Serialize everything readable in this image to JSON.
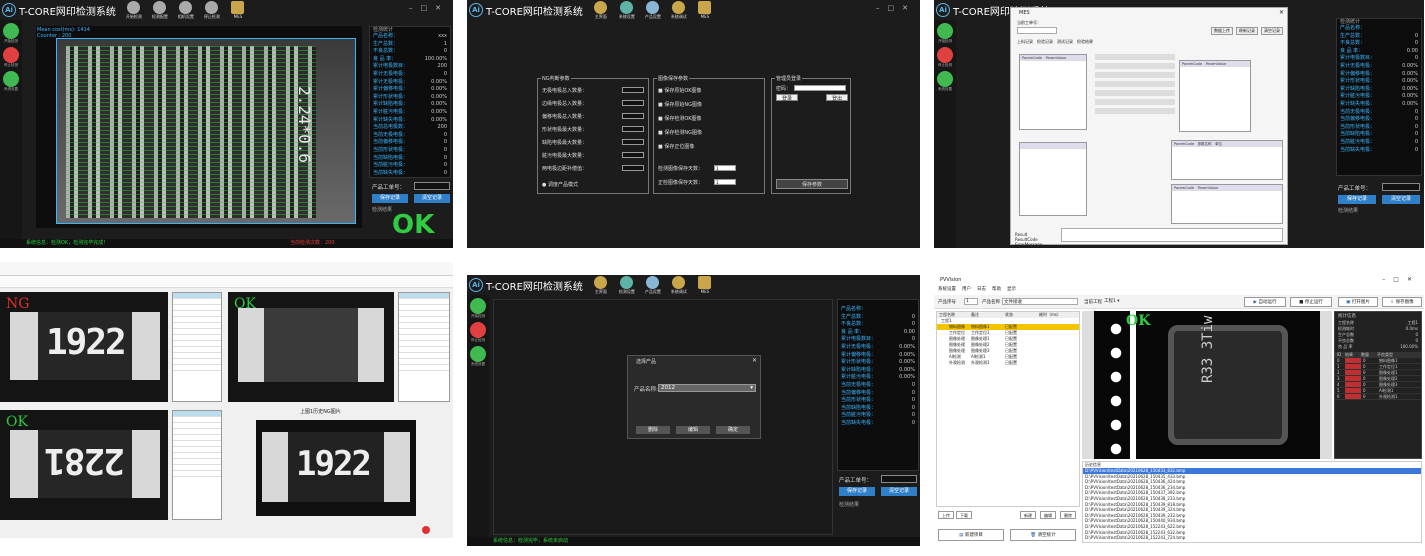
{
  "app": {
    "logo": "Ai",
    "title": "T-CORE网印检测系统"
  },
  "toolbar_colors": {
    "tool1": "#c9a64a",
    "tool2": "#5fb3a6",
    "tool3": "#8ab6d6",
    "tool4": "#c9a64a"
  },
  "panel1": {
    "toolbar": [
      "开始检测",
      "检测配置",
      "相机设置",
      "停止检测",
      "MES"
    ],
    "side": [
      "开始检测",
      "停止检测",
      "系统设置"
    ],
    "overlay_lines": [
      "Mean cost(ms): 1414",
      "Counter : 200"
    ],
    "result_group": "检测统计",
    "stats": [
      {
        "label": "产品名称：",
        "value": "xxx"
      },
      {
        "label": "生产总数：",
        "value": "1"
      },
      {
        "label": "不良总数：",
        "value": "0"
      },
      {
        "label": "良 品 率：",
        "value": "100.00%"
      },
      {
        "label": "累计电极数目：",
        "value": "200"
      },
      {
        "label": "累计无极电极：",
        "value": "0"
      },
      {
        "label": "累计无极电极：",
        "value": "0.00%"
      },
      {
        "label": "累计偏移电极：",
        "value": "0.00%"
      },
      {
        "label": "累计形状电极：",
        "value": "0.00%"
      },
      {
        "label": "累计缺陷电极：",
        "value": "0.00%"
      },
      {
        "label": "累计脏污电极：",
        "value": "0.00%"
      },
      {
        "label": "累计缺失电极：",
        "value": "0.00%"
      },
      {
        "label": "当前总电极数：",
        "value": "200"
      },
      {
        "label": "当前无极电极：",
        "value": "0"
      },
      {
        "label": "当前偏移电极：",
        "value": "0"
      },
      {
        "label": "当前形状电极：",
        "value": "0"
      },
      {
        "label": "当前缺陷电极：",
        "value": "0"
      },
      {
        "label": "当前脏污电极：",
        "value": "0"
      },
      {
        "label": "当前缺失电极：",
        "value": "0"
      }
    ],
    "product_no_label": "产品工单号：",
    "save_btn": "保存记录",
    "clear_btn": "清空记录",
    "result_label": "检测结果",
    "result_text": "OK",
    "status": "系统信息：检测OK，检测完毕完成！",
    "status_right": "当前检测次数：200",
    "image_text": "2.24*0.6"
  },
  "panel2": {
    "toolbar": [
      "主界面",
      "系统设置",
      "产品设置",
      "系统调试",
      "MES"
    ],
    "group1": "NG判断参数",
    "group1_rows": [
      "无极电极总入数量：",
      "边缘电极总入数量：",
      "偏移电极总入数量：",
      "形状电极最大数量：",
      "缺陷电极最大数量：",
      "脏污电极最大数量：",
      "两电极边距补偿值："
    ],
    "group1_check": "调度产品模式",
    "group2": "图像保存参数",
    "group2_rows": [
      "保存原始OK图像",
      "保存原始NG图像",
      "保存检测OK图像",
      "保存检测NG图像",
      "保存正位图像"
    ],
    "group2_inputs": [
      {
        "label": "检测图像保存天数：",
        "value": "1"
      },
      {
        "label": "正检图像保存天数：",
        "value": "1"
      }
    ],
    "group3": "管理员登录",
    "group3_pw": "密码：",
    "login_btn": "登录",
    "logout_btn": "登出",
    "save_params": "保存参数"
  },
  "panel3": {
    "dialog_title": "MES",
    "top_label": "当前工单号：",
    "tabs": [
      "上料记录",
      "检验记录",
      "测试记录",
      "检验结果"
    ],
    "right_btns": [
      "数据上传",
      "刷新记录",
      "清空记录"
    ],
    "grid1_headers": [
      "ParamCode",
      "ParamValue",
      "Unit"
    ],
    "grid2_headers": [
      "ParamCode",
      "ParamValue",
      "ParamName"
    ],
    "grid3_headers": [
      "ParamCode",
      "参数名称",
      "单位"
    ],
    "msg_labels": [
      "Result",
      "ResultCode",
      "ErrorMessage"
    ],
    "stats_title": "检测统计",
    "stats": [
      {
        "label": "产品名称：",
        "value": ""
      },
      {
        "label": "生产总数：",
        "value": "0"
      },
      {
        "label": "不良总数：",
        "value": "0"
      },
      {
        "label": "良 品 率：",
        "value": "0.00"
      },
      {
        "label": "累计电极数目：",
        "value": "0"
      },
      {
        "label": "累计无极电极：",
        "value": "0.00%"
      },
      {
        "label": "累计偏移电极：",
        "value": "0.00%"
      },
      {
        "label": "累计形状电极：",
        "value": "0.00%"
      },
      {
        "label": "累计缺陷电极：",
        "value": "0.00%"
      },
      {
        "label": "累计脏污电极：",
        "value": "0.00%"
      },
      {
        "label": "累计缺失电极：",
        "value": "0.00%"
      },
      {
        "label": "当前无极电极：",
        "value": "0"
      },
      {
        "label": "当前偏移电极：",
        "value": "0"
      },
      {
        "label": "当前形状电极：",
        "value": "0"
      },
      {
        "label": "当前缺陷电极：",
        "value": "0"
      },
      {
        "label": "当前脏污电极：",
        "value": "0"
      },
      {
        "label": "当前缺失电极：",
        "value": "0"
      }
    ],
    "product_no_label": "产品工单号：",
    "save_btn": "保存记录",
    "clear_btn": "清空记录",
    "result_label": "检测结果"
  },
  "panel4": {
    "ng_text": "NG",
    "ok_text": "OK",
    "chip_text_a": "1922",
    "chip_text_b": "2281",
    "chip_text_c": "1922",
    "bottom_caption": "上图1历史NG图片"
  },
  "panel5": {
    "toolbar": [
      "主界面",
      "检测设置",
      "产品设置",
      "系统调试",
      "MES"
    ],
    "dialog_title": "选择产品",
    "product_label": "产品名称:",
    "product_value": "2012",
    "btns": [
      "删除",
      "编辑",
      "确定"
    ],
    "stats": [
      {
        "label": "产品名称：",
        "value": ""
      },
      {
        "label": "生产总数：",
        "value": "0"
      },
      {
        "label": "不良总数：",
        "value": "0"
      },
      {
        "label": "良 品 率：",
        "value": "0.00"
      },
      {
        "label": "累计电极数目：",
        "value": "0"
      },
      {
        "label": "累计无极电极：",
        "value": "0.00%"
      },
      {
        "label": "累计偏移电极：",
        "value": "0.00%"
      },
      {
        "label": "累计形状电极：",
        "value": "0.00%"
      },
      {
        "label": "累计缺陷电极：",
        "value": "0.00%"
      },
      {
        "label": "累计脏污电极：",
        "value": "0.00%"
      },
      {
        "label": "当前无极电极：",
        "value": "0"
      },
      {
        "label": "当前偏移电极：",
        "value": "0"
      },
      {
        "label": "当前形状电极：",
        "value": "0"
      },
      {
        "label": "当前缺陷电极：",
        "value": "0"
      },
      {
        "label": "当前脏污电极：",
        "value": "0"
      },
      {
        "label": "当前缺失电极：",
        "value": "0"
      }
    ],
    "product_no_label": "产品工单号：",
    "save_btn": "保存记录",
    "clear_btn": "清空记录",
    "result_label": "检测结果",
    "status": "系统信息：检测完毕，系统未启动"
  },
  "panel6": {
    "title": "PVVision",
    "menu": [
      "系统设置",
      "用户",
      "日志",
      "帮助",
      "显示"
    ],
    "product_no_label": "产品序号",
    "product_no": "1",
    "product_name_label": "产品名称",
    "product_name": "文件接收",
    "station_label": "当前工程",
    "station_value": "工程1",
    "top_btns": [
      "自动运行",
      "停止运行",
      "打开图片",
      "保存图像"
    ],
    "tree_header": [
      "工程名称",
      "备注",
      "状态",
      "耗时（ms）"
    ],
    "tree_rows": [
      [
        "工程1",
        "",
        "",
        ""
      ],
      [
        "物料图像",
        "物料图像1",
        "已配置",
        ""
      ],
      [
        "工作定位",
        "工作定位1",
        "已配置",
        ""
      ],
      [
        "图像处理",
        "图像处理1",
        "已配置",
        ""
      ],
      [
        "图像处理",
        "图像处理2",
        "已配置",
        ""
      ],
      [
        "图像处理",
        "图像处理3",
        "已配置",
        ""
      ],
      [
        "AI检测",
        "AI检测1",
        "已配置",
        ""
      ],
      [
        "外观检测",
        "外观检测1",
        "已配置",
        ""
      ]
    ],
    "ok_text": "OK",
    "chip_text": "R33 3Tiw",
    "info_title": "统计信息",
    "info_rows": [
      [
        "工程名称",
        "工程1"
      ],
      [
        "检测耗时",
        "0.0ms"
      ],
      [
        "生产总数",
        "0"
      ],
      [
        "不良总数",
        "0"
      ],
      [
        "良 品 率",
        "100.00%"
      ]
    ],
    "table_headers": [
      "ID",
      "结果",
      "数量",
      "不良类型"
    ],
    "table_rows": [
      [
        "0",
        "",
        "0",
        "物料图像1"
      ],
      [
        "1",
        "",
        "0",
        "工作定位1"
      ],
      [
        "2",
        "",
        "0",
        "图像处理1"
      ],
      [
        "3",
        "",
        "0",
        "图像处理2"
      ],
      [
        "4",
        "",
        "0",
        "图像处理3"
      ],
      [
        "5",
        "",
        "0",
        "AI检测1"
      ],
      [
        "6",
        "",
        "0",
        "外观检测1"
      ]
    ],
    "log_title": "历史信息",
    "logs": [
      "D:\\PVVision\\testData\\20210628_150433_832.bmp",
      "D:\\PVVision\\testData\\20210628_150435_433.bmp",
      "D:\\PVVision\\testData\\20210628_150436_424.bmp",
      "D:\\PVVision\\testData\\20210628_150436_234.bmp",
      "D:\\PVVision\\testData\\20210628_150437_392.bmp",
      "D:\\PVVision\\testData\\20210628_150438_233.bmp",
      "D:\\PVVision\\testData\\20210628_150439_818.bmp",
      "D:\\PVVision\\testData\\20210628_150439_324.bmp",
      "D:\\PVVision\\testData\\20210628_150439_232.bmp",
      "D:\\PVVision\\testData\\20210628_150440_934.bmp",
      "D:\\PVVision\\testData\\20210628_152243_622.bmp",
      "D:\\PVVision\\testData\\20210628_152243_632.bmp",
      "D:\\PVVision\\testData\\20210628_152243_724.bmp"
    ],
    "bottom_btns": [
      "上传",
      "下载",
      "新建",
      "编辑",
      "删除"
    ],
    "footer_btns": [
      "新建项目",
      "清空统计"
    ]
  }
}
